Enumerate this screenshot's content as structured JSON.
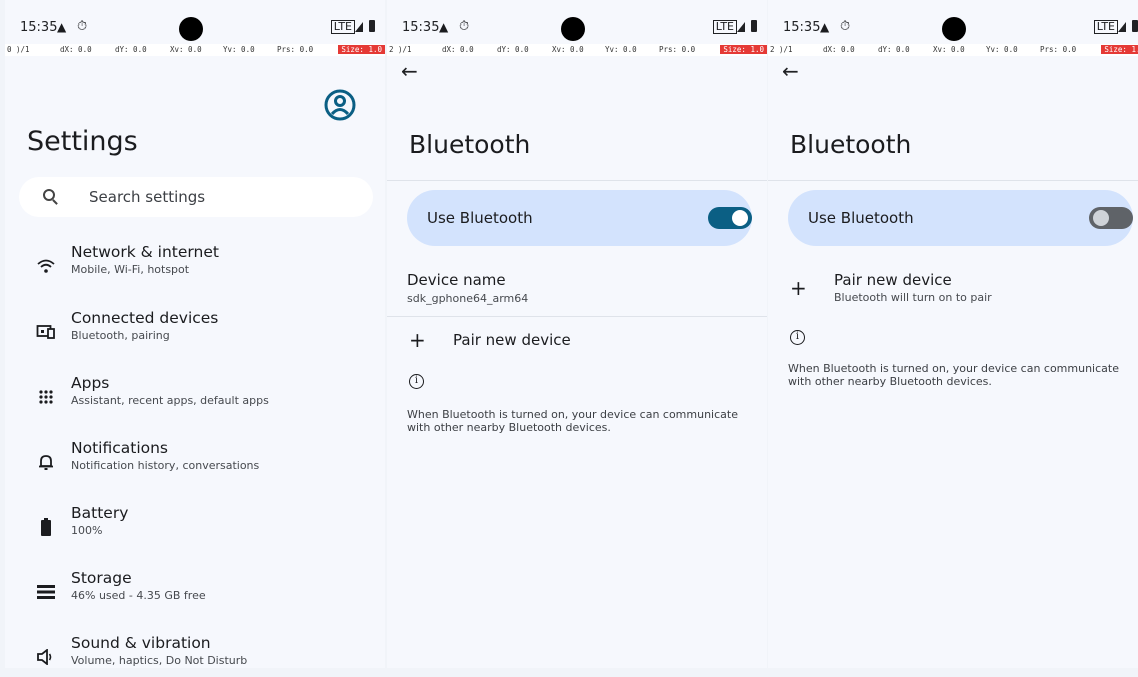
{
  "status": {
    "time": "15:35",
    "network": "LTE"
  },
  "devbar": {
    "pointers": [
      "0 )/1",
      "2 )/1",
      "2 )/1"
    ],
    "dx": "dX: 0.0",
    "dy": "dY: 0.0",
    "xv": "Xv: 0.0",
    "yv": "Yv: 0.0",
    "prs": "Prs: 0.0",
    "size": "Size: 1.0"
  },
  "settings": {
    "title": "Settings",
    "search_placeholder": "Search settings",
    "items": [
      {
        "title": "Network & internet",
        "subtitle": "Mobile, Wi-Fi, hotspot",
        "icon": "wifi-icon"
      },
      {
        "title": "Connected devices",
        "subtitle": "Bluetooth, pairing",
        "icon": "connected-devices-icon"
      },
      {
        "title": "Apps",
        "subtitle": "Assistant, recent apps, default apps",
        "icon": "apps-grid-icon"
      },
      {
        "title": "Notifications",
        "subtitle": "Notification history, conversations",
        "icon": "bell-icon"
      },
      {
        "title": "Battery",
        "subtitle": "100%",
        "icon": "battery-icon"
      },
      {
        "title": "Storage",
        "subtitle": "46% used - 4.35 GB free",
        "icon": "storage-icon"
      },
      {
        "title": "Sound & vibration",
        "subtitle": "Volume, haptics, Do Not Disturb",
        "icon": "speaker-icon"
      }
    ]
  },
  "bluetooth_on": {
    "title": "Bluetooth",
    "use_label": "Use Bluetooth",
    "toggle_state": "on",
    "device_name_label": "Device name",
    "device_name_value": "sdk_gphone64_arm64",
    "pair_label": "Pair new device",
    "info_text": "When Bluetooth is turned on, your device can communicate with other nearby Bluetooth devices."
  },
  "bluetooth_off": {
    "title": "Bluetooth",
    "use_label": "Use Bluetooth",
    "toggle_state": "off",
    "pair_label": "Pair new device",
    "pair_sub": "Bluetooth will turn on to pair",
    "info_text": "When Bluetooth is turned on, your device can communicate with other nearby Bluetooth devices."
  },
  "colors": {
    "toggle_on": "#0b5f84",
    "toggle_off": "#5f6368",
    "card": "#d3e3fd",
    "size_badge": "#e53935"
  }
}
